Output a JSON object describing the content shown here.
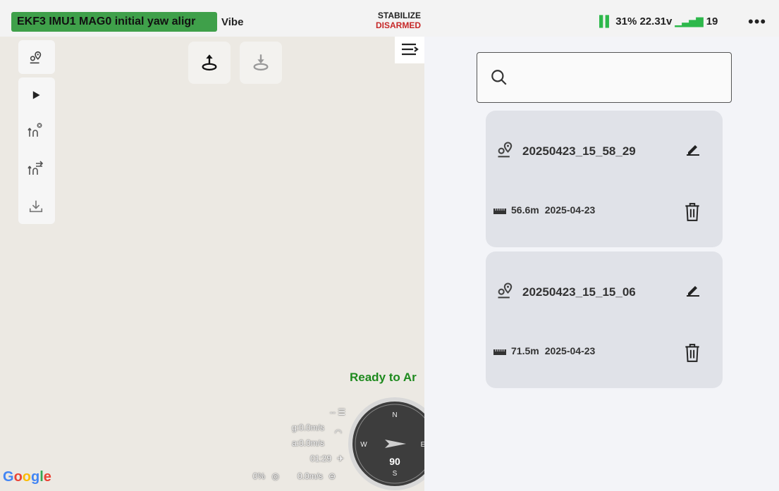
{
  "topbar": {
    "status_message": "EKF3 IMU1 MAG0 initial yaw aligr",
    "vibe_label": "Vibe",
    "flight_mode": "STABILIZE",
    "arm_state": "DISARMED",
    "battery_percent": "31%",
    "battery_voltage": "22.31v",
    "satellites": "19",
    "more_icon": "more-horizontal-icon"
  },
  "map": {
    "ready_text": "Ready to Ar",
    "hud": {
      "dist": "--",
      "ground_speed": "g:0.0m/s",
      "air_speed": "a:0.0m/s",
      "flight_time": "01:29",
      "throttle": "0%",
      "climb": "0.0m/s"
    },
    "compass": {
      "heading": "90",
      "north": "N",
      "south": "S",
      "west": "W",
      "east": "E"
    },
    "attribution": "Google",
    "tools": [
      "waypoint-icon",
      "play-icon",
      "route-clear-icon",
      "route-swap-icon",
      "download-icon"
    ],
    "float_buttons": [
      "upload-mission-icon",
      "download-mission-icon"
    ]
  },
  "missions": [
    {
      "name": "20250423_15_58_29",
      "distance": "56.6m",
      "date": "2025-04-23"
    },
    {
      "name": "20250423_15_15_06",
      "distance": "71.5m",
      "date": "2025-04-23"
    }
  ],
  "colors": {
    "status_green": "#3fa04a",
    "disarmed_red": "#c62828",
    "ready_green": "#1e8a1e",
    "card_bg": "#e0e2e8"
  }
}
